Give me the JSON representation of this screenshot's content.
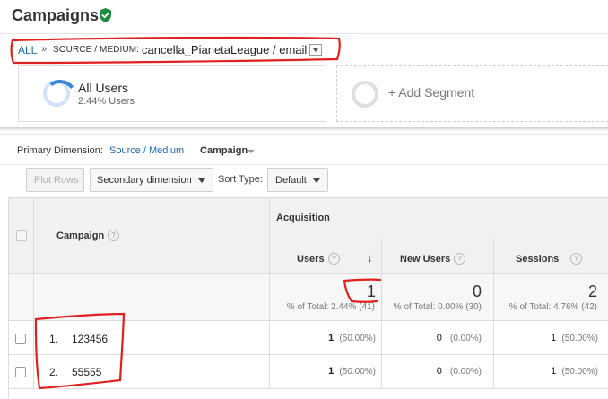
{
  "header": {
    "title": "Campaigns",
    "verified_icon": "shield-check-icon",
    "verified_color": "#1e8e3e"
  },
  "breadcrumb": {
    "all": "ALL",
    "separator": "»",
    "dimension": "SOURCE / MEDIUM:",
    "value": "cancella_PianetaLeague / email"
  },
  "segments": [
    {
      "name": "All Users",
      "detail": "2.44% Users"
    },
    {
      "name": "+ Add Segment"
    }
  ],
  "dimension_bar": {
    "label": "Primary Dimension:",
    "options": [
      "Source / Medium",
      "Campaign"
    ],
    "active": "Campaign"
  },
  "toolbar": {
    "plot_rows": "Plot Rows",
    "secondary": "Secondary dimension",
    "sort_label": "Sort Type:",
    "sort_value": "Default"
  },
  "table": {
    "group_header": "Acquisition",
    "columns": {
      "campaign": "Campaign",
      "users": "Users",
      "new_users": "New Users",
      "sessions": "Sessions"
    },
    "help_glyph": "?",
    "sort_glyph": "↓",
    "totals": {
      "users": "1",
      "users_pct": "% of Total: 2.44% (41)",
      "new_users": "0",
      "new_users_pct": "% of Total: 0.00% (30)",
      "sessions": "2",
      "sessions_pct": "% of Total: 4.76% (42)"
    },
    "rows": [
      {
        "index": "1.",
        "campaign": "123456",
        "users": "1",
        "users_pct": "(50.00%)",
        "new_users": "0",
        "new_users_pct": "(0.00%)",
        "sessions": "1",
        "sessions_pct": "(50.00%)"
      },
      {
        "index": "2.",
        "campaign": "55555",
        "users": "1",
        "users_pct": "(50.00%)",
        "new_users": "0",
        "new_users_pct": "(0.00%)",
        "sessions": "1",
        "sessions_pct": "(50.00%)"
      }
    ]
  },
  "colors": {
    "link": "#1a6ab8",
    "annotation": "#e0201f",
    "segment_ring": "#3b88d8"
  }
}
